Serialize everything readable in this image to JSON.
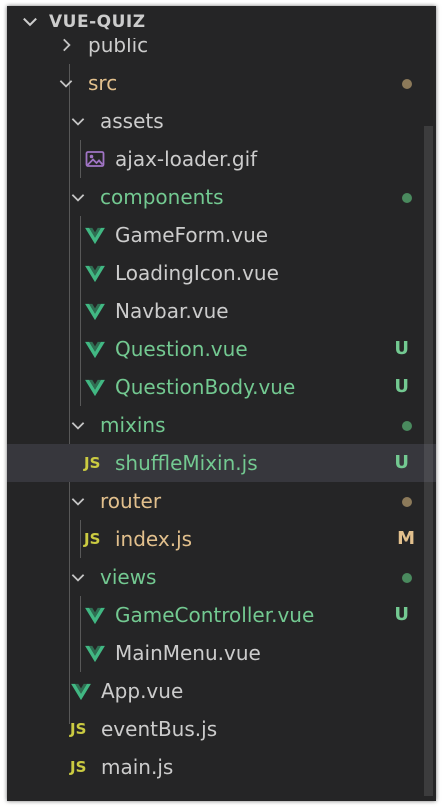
{
  "explorer": {
    "title": "VUE-QUIZ"
  },
  "colors": {
    "default_text": "#cccccc",
    "untracked": "#73c991",
    "modified": "#e2c08d",
    "untracked_dot": "#4a8a5e",
    "modified_dot": "#8c7a5a",
    "vue_green": "#41b883",
    "js_yellow": "#cbcb41",
    "gif_purple": "#a074c4",
    "background": "#252526",
    "selected_row": "#37373d"
  },
  "tree": [
    {
      "name": "public",
      "type": "folder",
      "expanded": false,
      "status": ""
    },
    {
      "name": "src",
      "type": "folder",
      "expanded": true,
      "status": "modified-dot"
    },
    {
      "name": "assets",
      "type": "folder",
      "expanded": true,
      "status": ""
    },
    {
      "name": "ajax-loader.gif",
      "type": "gif",
      "status": ""
    },
    {
      "name": "components",
      "type": "folder",
      "expanded": true,
      "status": "untracked-dot"
    },
    {
      "name": "GameForm.vue",
      "type": "vue",
      "status": ""
    },
    {
      "name": "LoadingIcon.vue",
      "type": "vue",
      "status": ""
    },
    {
      "name": "Navbar.vue",
      "type": "vue",
      "status": ""
    },
    {
      "name": "Question.vue",
      "type": "vue",
      "status": "U"
    },
    {
      "name": "QuestionBody.vue",
      "type": "vue",
      "status": "U"
    },
    {
      "name": "mixins",
      "type": "folder",
      "expanded": true,
      "status": "untracked-dot"
    },
    {
      "name": "shuffleMixin.js",
      "type": "js",
      "status": "U",
      "selected": true
    },
    {
      "name": "router",
      "type": "folder",
      "expanded": true,
      "status": "modified-dot"
    },
    {
      "name": "index.js",
      "type": "js",
      "status": "M"
    },
    {
      "name": "views",
      "type": "folder",
      "expanded": true,
      "status": "untracked-dot"
    },
    {
      "name": "GameController.vue",
      "type": "vue",
      "status": "U"
    },
    {
      "name": "MainMenu.vue",
      "type": "vue",
      "status": ""
    },
    {
      "name": "App.vue",
      "type": "vue",
      "status": ""
    },
    {
      "name": "eventBus.js",
      "type": "js",
      "status": ""
    },
    {
      "name": "main.js",
      "type": "js",
      "status": ""
    }
  ],
  "icons": {
    "folder_collapsed": "chevron-right-icon",
    "folder_expanded": "chevron-down-icon",
    "vue_file": "vue-file-icon",
    "js_file": "js-file-icon",
    "gif_file": "image-file-icon"
  },
  "js_icon_text": "JS"
}
